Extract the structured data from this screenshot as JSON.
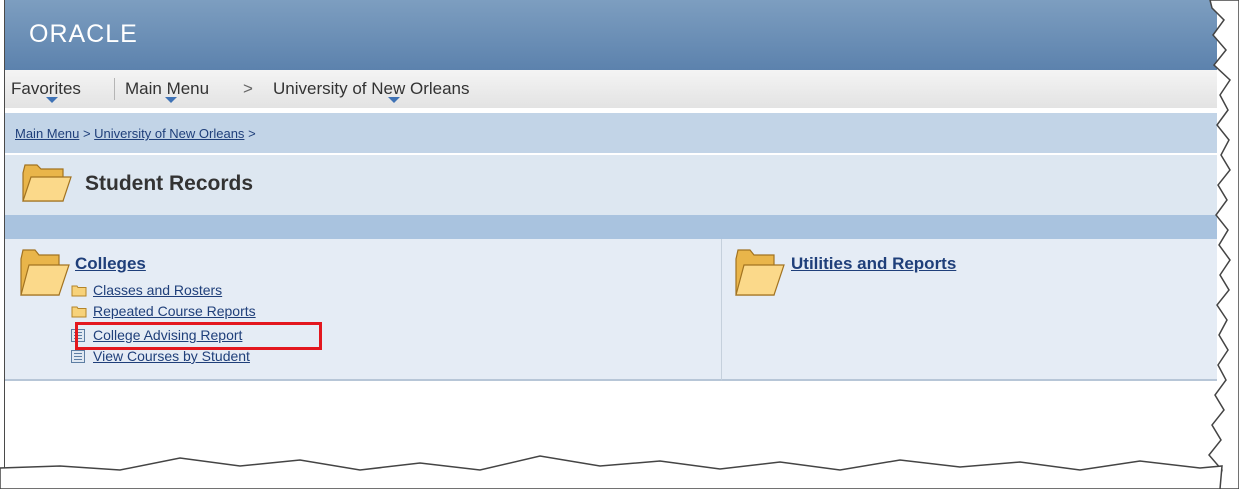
{
  "header": {
    "logo_text": "ORACLE"
  },
  "nav": {
    "favorites": "Favorites",
    "main_menu": "Main Menu",
    "separator": ">",
    "university": "University of New Orleans"
  },
  "breadcrumb": {
    "main_menu": "Main Menu",
    "separator": ">",
    "university": "University of New Orleans",
    "trailing_separator": ">"
  },
  "page": {
    "title": "Student Records"
  },
  "left_panel": {
    "category": "Colleges",
    "items": [
      {
        "label": "Classes and Rosters",
        "icon": "folder-icon"
      },
      {
        "label": "Repeated Course Reports",
        "icon": "folder-icon"
      },
      {
        "label": "College Advising Report",
        "icon": "report-icon",
        "highlighted": true
      },
      {
        "label": "View Courses by Student",
        "icon": "report-icon"
      }
    ]
  },
  "right_panel": {
    "category": "Utilities and Reports"
  },
  "colors": {
    "header_blue": "#5c82ad",
    "link_blue": "#1f3f7a",
    "breadcrumb_bg": "#c2d4e7",
    "panel_bg": "#e5ecf5",
    "highlight_red": "#e3171e",
    "folder_yellow": "#f7d27a"
  }
}
